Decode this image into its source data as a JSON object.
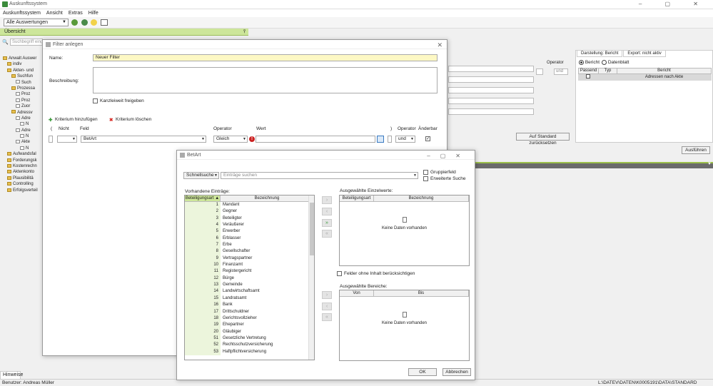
{
  "app": {
    "title": "Auskunftssystem",
    "window_controls": "– ▢ ✕"
  },
  "menu": [
    "Auskunftssystem",
    "Ansicht",
    "Extras",
    "Hilfe"
  ],
  "toolbar": {
    "view_combo": "Alle Auswertungen"
  },
  "greenbar": {
    "label": "Übersicht"
  },
  "search": {
    "placeholder": "Suchbegriff eing"
  },
  "tree": [
    "Anwalt Auswer",
    "indiv",
    "Akten- und",
    "Suchfun",
    "Such",
    "Prozessa",
    "Proz",
    "Proz",
    "Zuor",
    "Adressv",
    "Adre",
    "N",
    "Adre",
    "N",
    "Akte",
    "N",
    "Aufwandsfal",
    "Forderungsk",
    "Kostenrechn",
    "Aktenkonto",
    "Plausibilitä",
    "Controlling",
    "Erfolgsverteil"
  ],
  "right_panel": {
    "tabs": [
      "Darstellung: Bericht",
      "Export: nicht aktiv"
    ],
    "radio_bericht": "Bericht",
    "radio_datenblatt": "Datenblatt",
    "cols": [
      "Passend",
      "Typ",
      "Bericht"
    ],
    "row_bericht": "Adressen nach Akte",
    "operator_label": "Operator",
    "und": "und",
    "reset_btn": "Auf Standard zurücksetzen",
    "run_btn": "Ausführen"
  },
  "status": {
    "user": "Benutzer: Andreas Müller",
    "path": "L:\\DATEV\\DATEN\\K0005191\\DATA\\STANDARD",
    "tab": "Hinweise"
  },
  "filter_dialog": {
    "title": "Filter anlegen",
    "name_label": "Name:",
    "name_value": "Neuer Filter",
    "desc_label": "Beschreibung:",
    "share_label": "Kanzleiweit freigeben",
    "add_label": "Kriterium hinzufügen",
    "del_label": "Kriterium löschen",
    "col_paren_open": "(",
    "col_nicht": "Nicht",
    "col_feld": "Feld",
    "col_operator": "Operator",
    "col_wert": "Wert",
    "col_paren_close": ")",
    "col_operator2": "Operator",
    "col_aenderbar": "Änderbar",
    "row_feld": "BetArt",
    "row_operator": "Gleich",
    "row_op2": "und"
  },
  "betart_dialog": {
    "title": "BetArt",
    "mode": "Schnellsuche",
    "search_placeholder": "Einträge suchen",
    "group_label": "Gruppierfeld",
    "ext_label": "Erweiterte Suche",
    "available_label": "Vorhandene Einträge:",
    "cols": [
      "Beteiligungsart",
      "Bezeichnung"
    ],
    "rows": [
      {
        "n": "1",
        "b": "Mandant"
      },
      {
        "n": "2",
        "b": "Gegner"
      },
      {
        "n": "3",
        "b": "Beteiligter"
      },
      {
        "n": "4",
        "b": "Veräußerer"
      },
      {
        "n": "5",
        "b": "Erwerber"
      },
      {
        "n": "6",
        "b": "Erblasser"
      },
      {
        "n": "7",
        "b": "Erbe"
      },
      {
        "n": "8",
        "b": "Gesellschafter"
      },
      {
        "n": "9",
        "b": "Vertragspartner"
      },
      {
        "n": "10",
        "b": "Finanzamt"
      },
      {
        "n": "11",
        "b": "Registergericht"
      },
      {
        "n": "12",
        "b": "Bürge"
      },
      {
        "n": "13",
        "b": "Gemeinde"
      },
      {
        "n": "14",
        "b": "Landwirtschaftsamt"
      },
      {
        "n": "15",
        "b": "Landratsamt"
      },
      {
        "n": "16",
        "b": "Bank"
      },
      {
        "n": "17",
        "b": "Drittschuldner"
      },
      {
        "n": "18",
        "b": "Gerichtsvollzieher"
      },
      {
        "n": "19",
        "b": "Ehepartner"
      },
      {
        "n": "20",
        "b": "Gläubiger"
      },
      {
        "n": "51",
        "b": "Gesetzliche Vertretung"
      },
      {
        "n": "52",
        "b": "Rechtsschutzversicherung"
      },
      {
        "n": "53",
        "b": "Haftpflichtversicherung"
      }
    ],
    "selected_label": "Ausgewählte Einzelwerte:",
    "selected_cols": [
      "Beteiligungsart",
      "Bezeichnung"
    ],
    "empty_text": "Keine Daten vorhanden",
    "empty_fields_label": "Felder ohne Inhalt berücksichtigen",
    "ranges_label": "Ausgewählte Bereiche:",
    "range_cols": [
      "Von",
      "Bis"
    ],
    "ok": "OK",
    "cancel": "Abbrechen"
  },
  "colors": {
    "green_bar": "#cde69a",
    "row_number_bg": "#ecf5dc",
    "accent_green": "#9cc04a",
    "delete_red": "#d9302a"
  }
}
